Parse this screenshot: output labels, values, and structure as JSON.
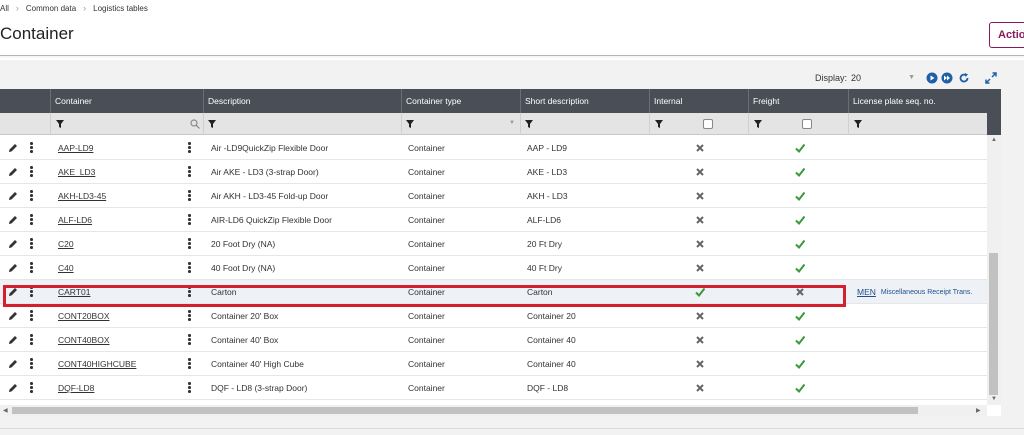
{
  "breadcrumb": {
    "items": [
      "All",
      "Common data",
      "Logistics tables"
    ]
  },
  "page": {
    "title": "Container",
    "action_label": "Actio"
  },
  "toolbar": {
    "display_label": "Display:",
    "display_value": "20"
  },
  "columns": {
    "container": "Container",
    "description": "Description",
    "container_type": "Container type",
    "short_description": "Short description",
    "internal": "Internal",
    "freight": "Freight",
    "license_plate": "License plate seq. no."
  },
  "rows": [
    {
      "container": "AAP-LD9",
      "description": "Air -LD9QuickZip Flexible Door",
      "type": "Container",
      "short": "AAP - LD9",
      "internal": false,
      "freight": true,
      "lp_code": "",
      "lp_desc": ""
    },
    {
      "container": "AKE_LD3",
      "description": "Air AKE - LD3 (3-strap Door)",
      "type": "Container",
      "short": "AKE - LD3",
      "internal": false,
      "freight": true,
      "lp_code": "",
      "lp_desc": ""
    },
    {
      "container": "AKH-LD3-45",
      "description": "Air AKH - LD3-45 Fold-up Door",
      "type": "Container",
      "short": "AKH - LD3",
      "internal": false,
      "freight": true,
      "lp_code": "",
      "lp_desc": ""
    },
    {
      "container": "ALF-LD6",
      "description": "AIR-LD6 QuickZip Flexible Door",
      "type": "Container",
      "short": "ALF-LD6",
      "internal": false,
      "freight": true,
      "lp_code": "",
      "lp_desc": ""
    },
    {
      "container": "C20",
      "description": "20 Foot Dry (NA)",
      "type": "Container",
      "short": "20 Ft Dry",
      "internal": false,
      "freight": true,
      "lp_code": "",
      "lp_desc": ""
    },
    {
      "container": "C40",
      "description": "40 Foot Dry (NA)",
      "type": "Container",
      "short": "40 Ft Dry",
      "internal": false,
      "freight": true,
      "lp_code": "",
      "lp_desc": ""
    },
    {
      "container": "CART01",
      "description": "Carton",
      "type": "Container",
      "short": "Carton",
      "internal": true,
      "freight": false,
      "lp_code": "MEN",
      "lp_desc": "Miscellaneous Receipt Trans."
    },
    {
      "container": "CONT20BOX",
      "description": "Container 20' Box",
      "type": "Container",
      "short": "Container 20",
      "internal": false,
      "freight": true,
      "lp_code": "",
      "lp_desc": ""
    },
    {
      "container": "CONT40BOX",
      "description": "Container 40' Box",
      "type": "Container",
      "short": "Container 40",
      "internal": false,
      "freight": true,
      "lp_code": "",
      "lp_desc": ""
    },
    {
      "container": "CONT40HIGHCUBE",
      "description": "Container 40' High Cube",
      "type": "Container",
      "short": "Container 40",
      "internal": false,
      "freight": true,
      "lp_code": "",
      "lp_desc": ""
    },
    {
      "container": "DQF-LD8",
      "description": "DQF - LD8 (3-strap Door)",
      "type": "Container",
      "short": "DQF - LD8",
      "internal": false,
      "freight": true,
      "lp_code": "",
      "lp_desc": ""
    }
  ],
  "colors": {
    "header_bg": "#4a4e57",
    "accent": "#8a1a5a",
    "check": "#3a9a3a",
    "cross": "#666666",
    "highlight": "#d4202d"
  }
}
